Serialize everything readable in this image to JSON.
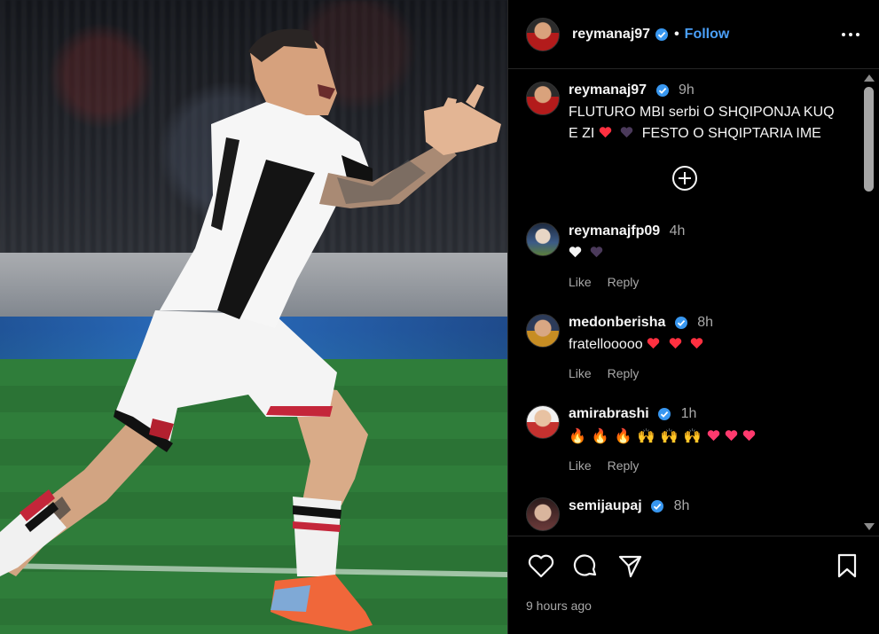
{
  "post": {
    "username": "reymanaj97",
    "follow_label": "Follow",
    "separator": "•",
    "caption_time": "9h",
    "caption_text": "FLUTURO MBI serbi O SHQIPONJA KUQ E ZI ❤️ 🖤 FESTO O SHQIPTARIA IME",
    "time_ago": "9 hours ago"
  },
  "comments": [
    {
      "username": "reymanaj97",
      "verified": true,
      "time": "9h",
      "text": "FLUTURO MBI serbi O SHQIPONJA KUQ E ZI ❤️ 🖤 FESTO O SHQIPTARIA IME"
    },
    {
      "username": "reymanajfp09",
      "verified": false,
      "time": "4h",
      "text": "🤍 🖤",
      "like": "Like",
      "reply": "Reply"
    },
    {
      "username": "medonberisha",
      "verified": true,
      "time": "8h",
      "text": "fratellooooo ❤️ ❤️ ❤️",
      "like": "Like",
      "reply": "Reply"
    },
    {
      "username": "amirabrashi",
      "verified": true,
      "time": "1h",
      "text": "🔥 🔥 🔥 🙌 🙌 🙌 ❤️ ❤️ ❤️",
      "like": "Like",
      "reply": "Reply"
    },
    {
      "username": "semijaupaj",
      "verified": true,
      "time": "8h"
    }
  ],
  "labels": {
    "like": "Like",
    "reply": "Reply",
    "comment_2_text": "fratellooooo",
    "caption_line_1": "FLUTURO MBI serbi O SHQIPONJA KUQ",
    "caption_line_2": "E ZI",
    "caption_line_3": "FESTO O SHQIPTARIA IME"
  },
  "icons": [
    "verified-icon",
    "more-options-icon",
    "add-comment-icon",
    "heart-icon",
    "comment-icon",
    "share-icon",
    "save-icon"
  ],
  "colors": {
    "accent": "#4a9ff8",
    "heart_red": "#ff3040",
    "muted": "#a8a8a8",
    "background": "#000000"
  }
}
